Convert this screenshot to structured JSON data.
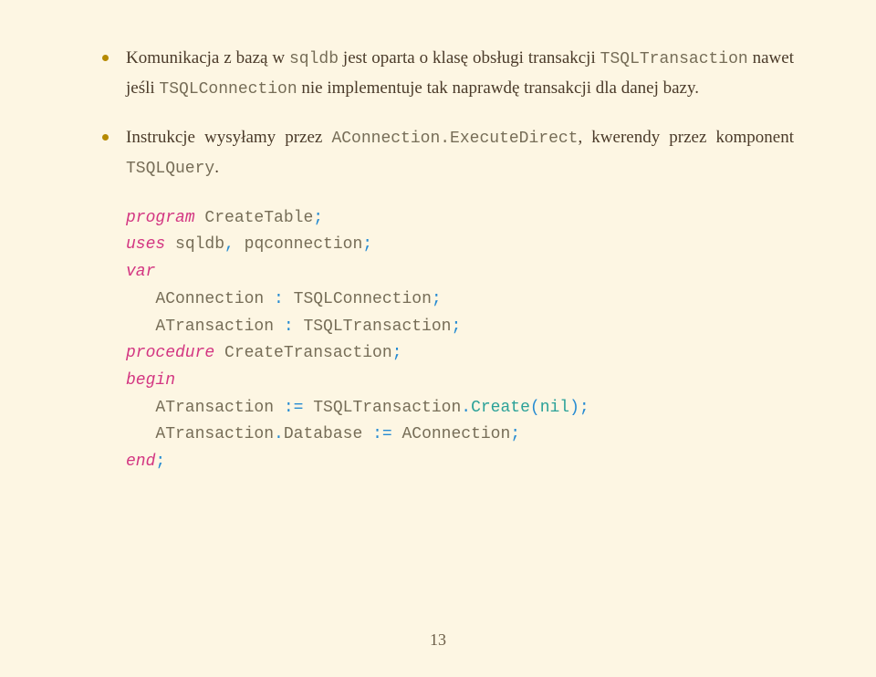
{
  "bullets": [
    {
      "prefix": "Komunikacja z bazą w ",
      "tt1": "sqldb",
      "mid1": " jest oparta o klasę obsługi transakcji ",
      "tt2": "TSQLTransaction",
      "mid2": " nawet jeśli ",
      "tt3": "TSQLConnection",
      "suffix": " nie implementuje tak naprawdę transakcji dla danej bazy."
    },
    {
      "prefix": "Instrukcje wysyłamy przez ",
      "tt1": "AConnection.ExecuteDirect",
      "mid1": ", kwerendy przez komponent ",
      "tt2": "TSQLQuery",
      "suffix": "."
    }
  ],
  "code": {
    "l1_kw": "program",
    "l1_name": " CreateTable",
    "l1_semi": ";",
    "l2_kw": "uses",
    "l2_rest": " sqldb",
    "l2_comma": ", ",
    "l2_rest2": "pqconnection",
    "l2_semi": ";",
    "l3_kw": "var",
    "l4_name": "   AConnection ",
    "l4_colon": ": ",
    "l4_type": "TSQLConnection",
    "l4_semi": ";",
    "l5_name": "   ATransaction ",
    "l5_colon": ": ",
    "l5_type": "TSQLTransaction",
    "l5_semi": ";",
    "l6_kw": "procedure",
    "l6_name": " CreateTransaction",
    "l6_semi": ";",
    "l7_kw": "begin",
    "l8_lhs": "   ATransaction ",
    "l8_assign": ":= ",
    "l8_type": "TSQLTransaction",
    "l8_dot": ".",
    "l8_call": "Create",
    "l8_paren1": "(",
    "l8_nil": "nil",
    "l8_paren2": ")",
    "l8_semi": ";",
    "l9_lhs": "   ATransaction",
    "l9_dot": ".",
    "l9_prop": "Database ",
    "l9_assign": ":= ",
    "l9_rhs": "AConnection",
    "l9_semi": ";",
    "l10_kw": "end",
    "l10_semi": ";"
  },
  "pagenum": "13"
}
